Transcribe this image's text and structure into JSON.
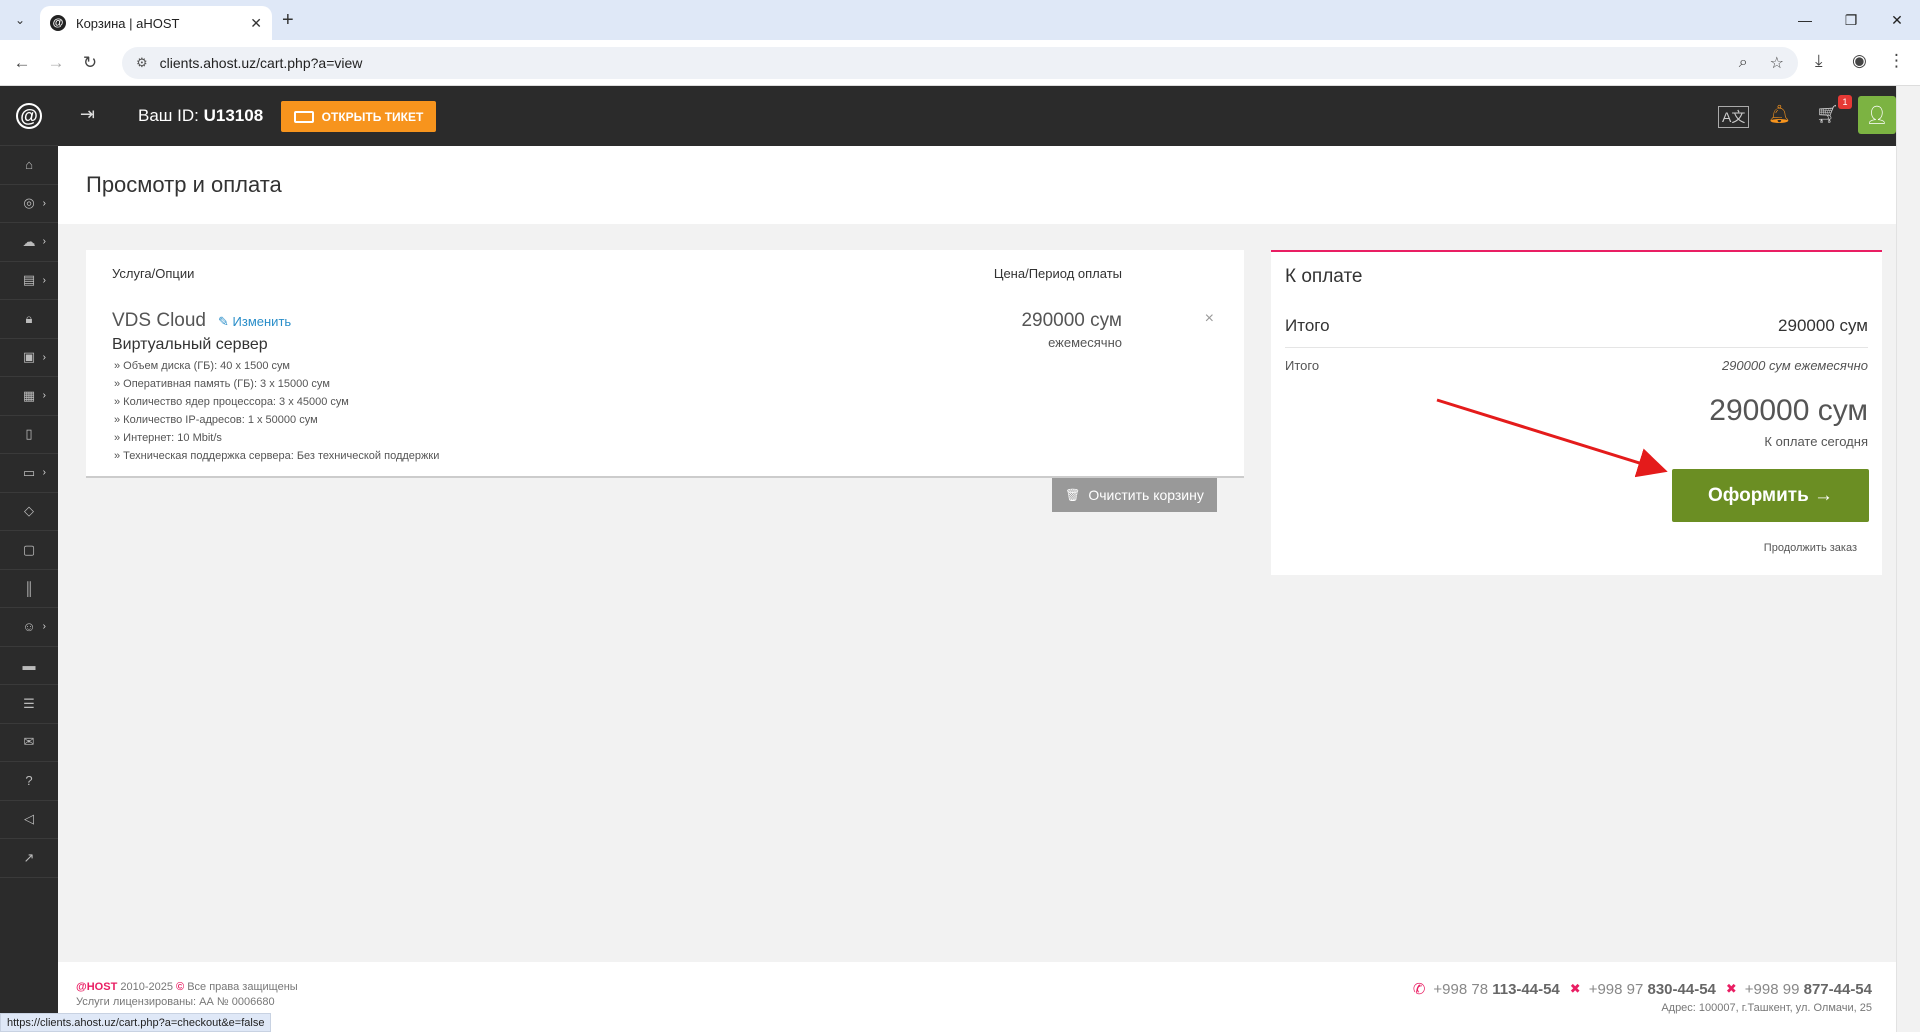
{
  "browser": {
    "tab_title": "Корзина | aHOST",
    "url": "clients.ahost.uz/cart.php?a=view",
    "status_url": "https://clients.ahost.uz/cart.php?a=checkout&e=false"
  },
  "header": {
    "id_label": "Ваш ID:",
    "user_id": "U13108",
    "ticket_button": "ОТКРЫТЬ ТИКЕТ",
    "cart_count": "1"
  },
  "page": {
    "title": "Просмотр и оплата"
  },
  "cart": {
    "col_service": "Услуга/Опции",
    "col_price": "Цена/Период оплаты",
    "product_name": "VDS Cloud",
    "edit_label": "Изменить",
    "product_group": "Виртуальный сервер",
    "options": [
      "» Объем диска (ГБ): 40 x 1500 сум",
      "» Оперативная память (ГБ): 3 x 15000 сум",
      "» Количество ядер процессора: 3 x 45000 сум",
      "» Количество IP-адресов: 1 x 50000 сум",
      "» Интернет: 10 Mbit/s",
      "» Техническая поддержка сервера: Без технической поддержки"
    ],
    "price": "290000 сум",
    "cycle": "ежемесячно",
    "remove": "×",
    "clear_button": "Очистить корзину"
  },
  "summary": {
    "title": "К оплате",
    "subtotal_label": "Итого",
    "subtotal_value": "290000 сум",
    "recurring_label": "Итого",
    "recurring_value": "290000 сум ежемесячно",
    "total": "290000 сум",
    "due_today": "К оплате сегодня",
    "checkout_button": "Оформить →",
    "continue_link": "Продолжить заказ"
  },
  "footer": {
    "brand": "@HOST",
    "copyright": "2010-2025",
    "rights": "Все права защищены",
    "license": "Услуги лицензированы: АА № 0006680",
    "phones": [
      {
        "prefix": "+998 78",
        "number": "113-44-54"
      },
      {
        "prefix": "+998 97",
        "number": "830-44-54"
      },
      {
        "prefix": "+998 99",
        "number": "877-44-54"
      }
    ],
    "address": "Адрес: 100007, г.Ташкент, ул. Олмачи, 25"
  },
  "icons": {
    "sidebar": [
      "home-icon",
      "globe-icon",
      "cloud-icon",
      "server-icon",
      "lock-icon",
      "disk-icon",
      "box-icon",
      "clipboard-icon",
      "wallet-icon",
      "piggy-bank-icon",
      "document-icon",
      "books-icon",
      "user-icon",
      "card-icon",
      "list-icon",
      "mail-icon",
      "help-icon",
      "megaphone-icon",
      "external-link-icon"
    ]
  },
  "colors": {
    "accent_orange": "#f7941d",
    "accent_green": "#6b8e23",
    "brand_pink": "#e91e63",
    "sidebar_dark": "#2b2b2b"
  }
}
